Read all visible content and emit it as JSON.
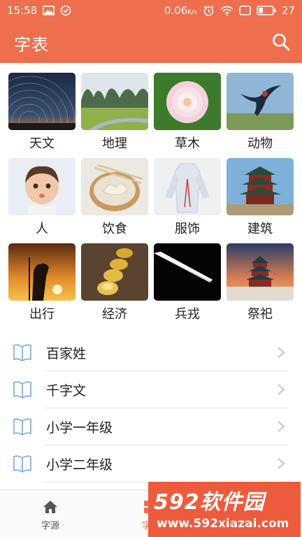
{
  "status_bar": {
    "time": "15:58",
    "speed": "0.06",
    "speed_unit": "K/s",
    "battery": "27",
    "left_icons": [
      "image-icon",
      "check-circle-icon"
    ],
    "right_icons": [
      "alarm-icon",
      "wifi-icon",
      "window-icon",
      "battery-icon"
    ]
  },
  "app_bar": {
    "title": "字表",
    "action_icon": "search-icon",
    "color": "#ee6e4e"
  },
  "categories": [
    {
      "label": "天文",
      "thumb": "star-trails"
    },
    {
      "label": "地理",
      "thumb": "karst-landscape"
    },
    {
      "label": "草木",
      "thumb": "dahlia-flower"
    },
    {
      "label": "动物",
      "thumb": "swallow-bird"
    },
    {
      "label": "人",
      "thumb": "child-portrait"
    },
    {
      "label": "饮食",
      "thumb": "dumplings"
    },
    {
      "label": "服饰",
      "thumb": "hanfu-robe"
    },
    {
      "label": "建筑",
      "thumb": "pagoda-tower"
    },
    {
      "label": "出行",
      "thumb": "sunset-traveler"
    },
    {
      "label": "经济",
      "thumb": "gold-ingots"
    },
    {
      "label": "兵戎",
      "thumb": "sword-blade"
    },
    {
      "label": "祭祀",
      "thumb": "temple-of-heaven"
    }
  ],
  "list": {
    "icon": "book-icon",
    "items": [
      {
        "label": "百家姓"
      },
      {
        "label": "千字文"
      },
      {
        "label": "小学一年级"
      },
      {
        "label": "小学二年级"
      }
    ]
  },
  "bottom_nav": {
    "items": [
      {
        "label": "字源",
        "icon": "home-icon",
        "active": false
      },
      {
        "label": "字表",
        "icon": "grid-icon",
        "active": true
      }
    ]
  },
  "watermark": {
    "line1": "592软件园",
    "line2": "www.592xiazai.com"
  }
}
